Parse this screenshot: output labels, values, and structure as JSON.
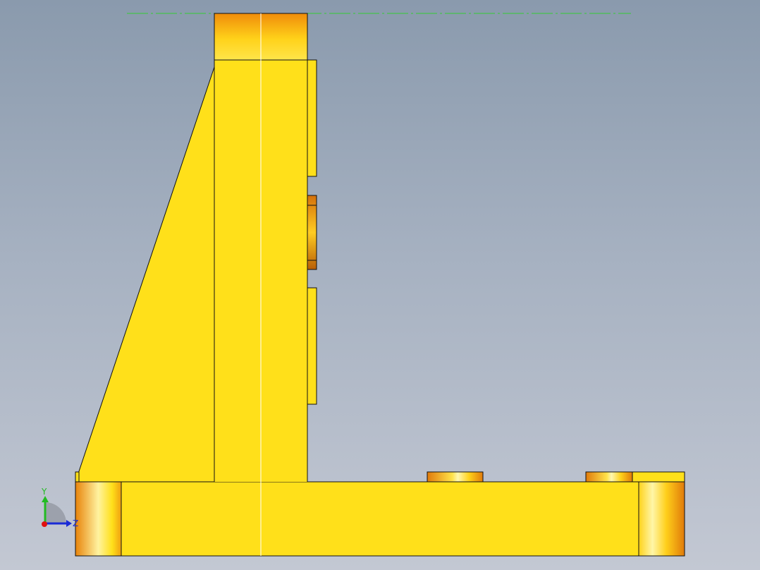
{
  "viewport": {
    "background_top": "#8a9aad",
    "background_bottom": "#c3c8d3"
  },
  "model": {
    "body_color": "#ffe01a",
    "cylinder_dark": "#e8830a",
    "cylinder_light": "#fff6a8",
    "edge_color": "#111111",
    "centerline_color": "#ffffff",
    "sketch_line_color": "#33cc33"
  },
  "triad": {
    "y_label": "Y",
    "z_label": "Z",
    "y_color": "#22bb22",
    "z_color": "#1a2bd6",
    "x_color": "#e01010"
  }
}
